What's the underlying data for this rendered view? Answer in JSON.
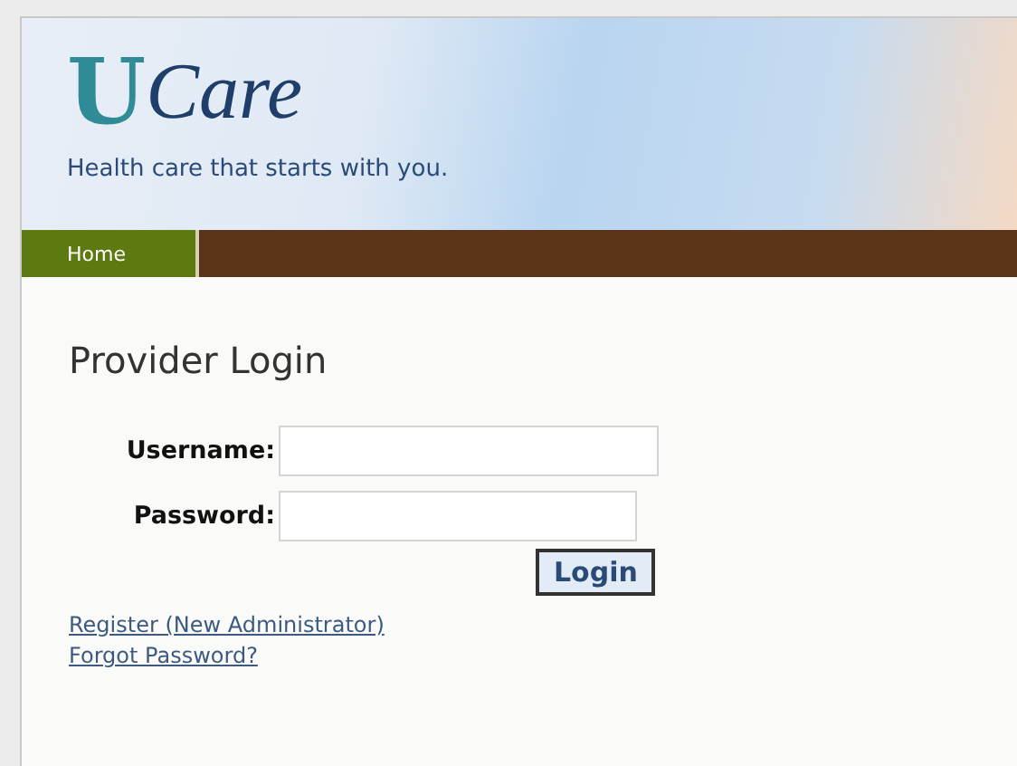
{
  "header": {
    "logo": {
      "mark": "U",
      "wordmark": "Care"
    },
    "tagline": "Health care that starts with you."
  },
  "nav": {
    "items": [
      {
        "label": "Home",
        "selected": true
      }
    ]
  },
  "login": {
    "title": "Provider Login",
    "fields": [
      {
        "label": "Username:"
      },
      {
        "label": "Password:"
      }
    ],
    "button": "Login",
    "links": [
      "Register (New Administrator)",
      "Forgot Password?"
    ]
  }
}
